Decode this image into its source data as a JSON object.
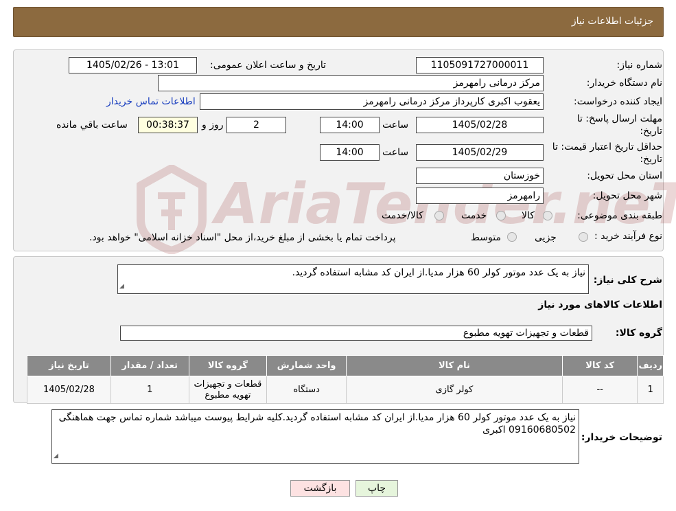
{
  "header": {
    "title": "جزئیات اطلاعات نیاز"
  },
  "fields": {
    "need_number_label": "شماره نیاز:",
    "need_number": "1105091727000011",
    "announce_label": "تاریخ و ساعت اعلان عمومی:",
    "announce_value": "1405/02/26 - 13:01",
    "buyer_label": "نام دستگاه خریدار:",
    "buyer_value": "مرکز درمانی رامهرمز",
    "creator_label": "ایجاد کننده درخواست:",
    "creator_value": "یعقوب اکبری کارپرداز مرکز درمانی رامهرمز",
    "contact_link": "اطلاعات تماس خریدار",
    "deadline_label_1": "مهلت ارسال پاسخ: تا",
    "deadline_label_2": "تاریخ:",
    "deadline_date": "1405/02/28",
    "time_label": "ساعت",
    "deadline_time": "14:00",
    "days_value": "2",
    "days_label": "روز و",
    "remaining_value": "00:38:37",
    "remaining_label": "ساعت باقي مانده",
    "validity_label_1": "حداقل تاریخ اعتبار قیمت: تا",
    "validity_label_2": "تاریخ:",
    "validity_date": "1405/02/29",
    "validity_time_label": "ساعت",
    "validity_time": "14:00",
    "province_label": "استان محل تحویل:",
    "province_value": "خوزستان",
    "city_label": "شهر محل تحویل:",
    "city_value": "رامهرمز",
    "category_label": "طبقه بندی موضوعی:",
    "category_options": [
      "کالا",
      "خدمت",
      "کالا/خدمت"
    ],
    "process_label": "نوع فرآیند خرید :",
    "process_options": [
      "جزیی",
      "متوسط"
    ],
    "process_note": "پرداخت تمام یا بخشی از مبلغ خرید،از محل \"اسناد خزانه اسلامی\" خواهد بود."
  },
  "summary": {
    "label": "شرح کلی نیاز:",
    "text": "نیاز به یک عدد موتور کولر 60 هزار مدیا.از ایران کد مشابه استفاده گردید."
  },
  "goods": {
    "section_title": "اطلاعات کالاهای مورد نیاز",
    "group_label": "گروه کالا:",
    "group_value": "قطعات و تجهیزات تهویه مطبوع",
    "columns": [
      "ردیف",
      "کد کالا",
      "نام کالا",
      "واحد شمارش",
      "گروه کالا",
      "تعداد / مقدار",
      "تاریخ نیاز"
    ],
    "rows": [
      [
        "1",
        "--",
        "کولر گازی",
        "دستگاه",
        "قطعات و تجهیزات تهویه مطبوع",
        "1",
        "1405/02/28"
      ]
    ]
  },
  "buyer_notes": {
    "label": "توضیحات خریدار:",
    "text": "نیاز به یک عدد موتور کولر 60 هزار مدیا.از ایران کد مشابه استفاده گردید.کلیه شرایط پیوست میباشد شماره تماس جهت هماهنگی 09160680502 اکبری"
  },
  "buttons": {
    "print": "چاپ",
    "back": "بازگشت"
  },
  "watermark": {
    "text": "AriaTender.neT"
  },
  "colors": {
    "header_bg": "#8c6a3f",
    "link": "#1a3fbf",
    "table_header": "#8a8a8a"
  }
}
